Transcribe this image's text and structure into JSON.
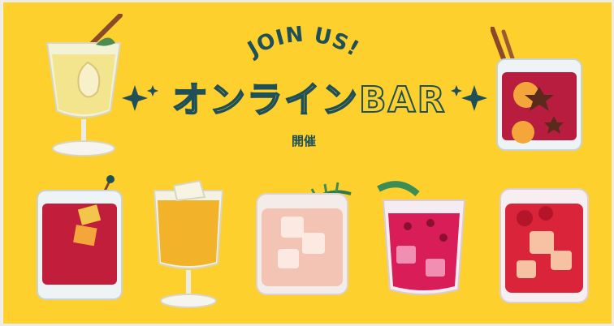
{
  "banner": {
    "join_text": "JOIN US!",
    "title": "オンラインBAR",
    "subtitle": "開催"
  },
  "colors": {
    "background": "#fdd02e",
    "text": "#1f4f57"
  },
  "icons": [
    "sparkle-icon",
    "cocktail-glass-icon"
  ]
}
